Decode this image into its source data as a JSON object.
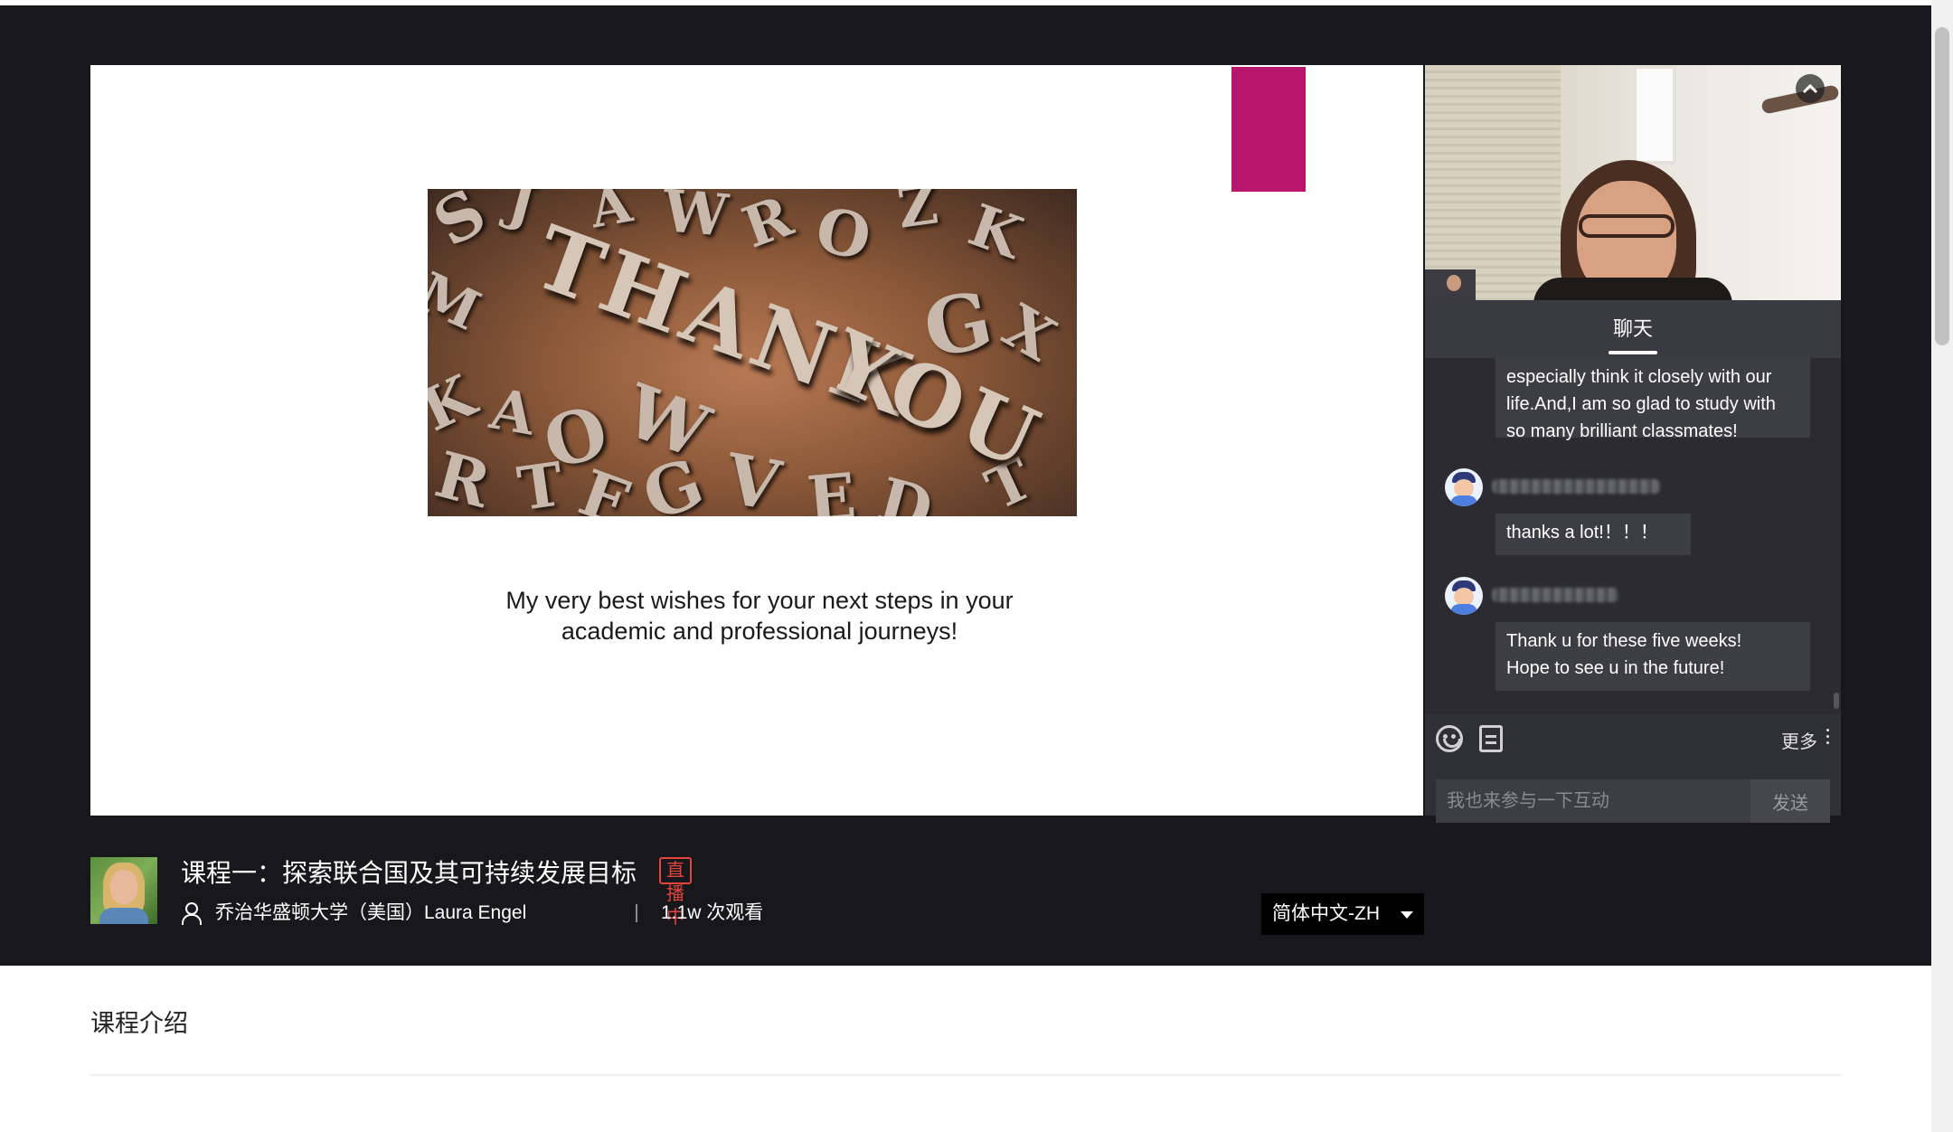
{
  "slide": {
    "image_words": [
      "THANK",
      "YOU"
    ],
    "text_line1": "My very best wishes for your next steps in your",
    "text_line2": "academic and professional journeys!"
  },
  "chat": {
    "tab_label": "聊天",
    "messages": [
      {
        "lines": [
          "especially think it closely with our",
          "life.And,I am so glad to study with",
          "so many brilliant classmates!"
        ]
      },
      {
        "lines": [
          "thanks a lot!！！！"
        ]
      },
      {
        "lines": [
          "Thank u for these five weeks!",
          "Hope to see u in the future!"
        ]
      }
    ],
    "more_label": "更多",
    "input_placeholder": "我也来参与一下互动",
    "send_label": "发送"
  },
  "course": {
    "title": "课程一：探索联合国及其可持续发展目标",
    "live_badge": "直播中",
    "instructor": "乔治华盛顿大学（美国）Laura Engel",
    "views": "1.1w 次观看",
    "language": "简体中文-ZH"
  },
  "intro": {
    "title": "课程介绍"
  },
  "colors": {
    "dark_bg": "#18181c",
    "chat_bg": "#2b2b31",
    "live_red": "#e2453c",
    "slide_accent": "#b8156c"
  }
}
